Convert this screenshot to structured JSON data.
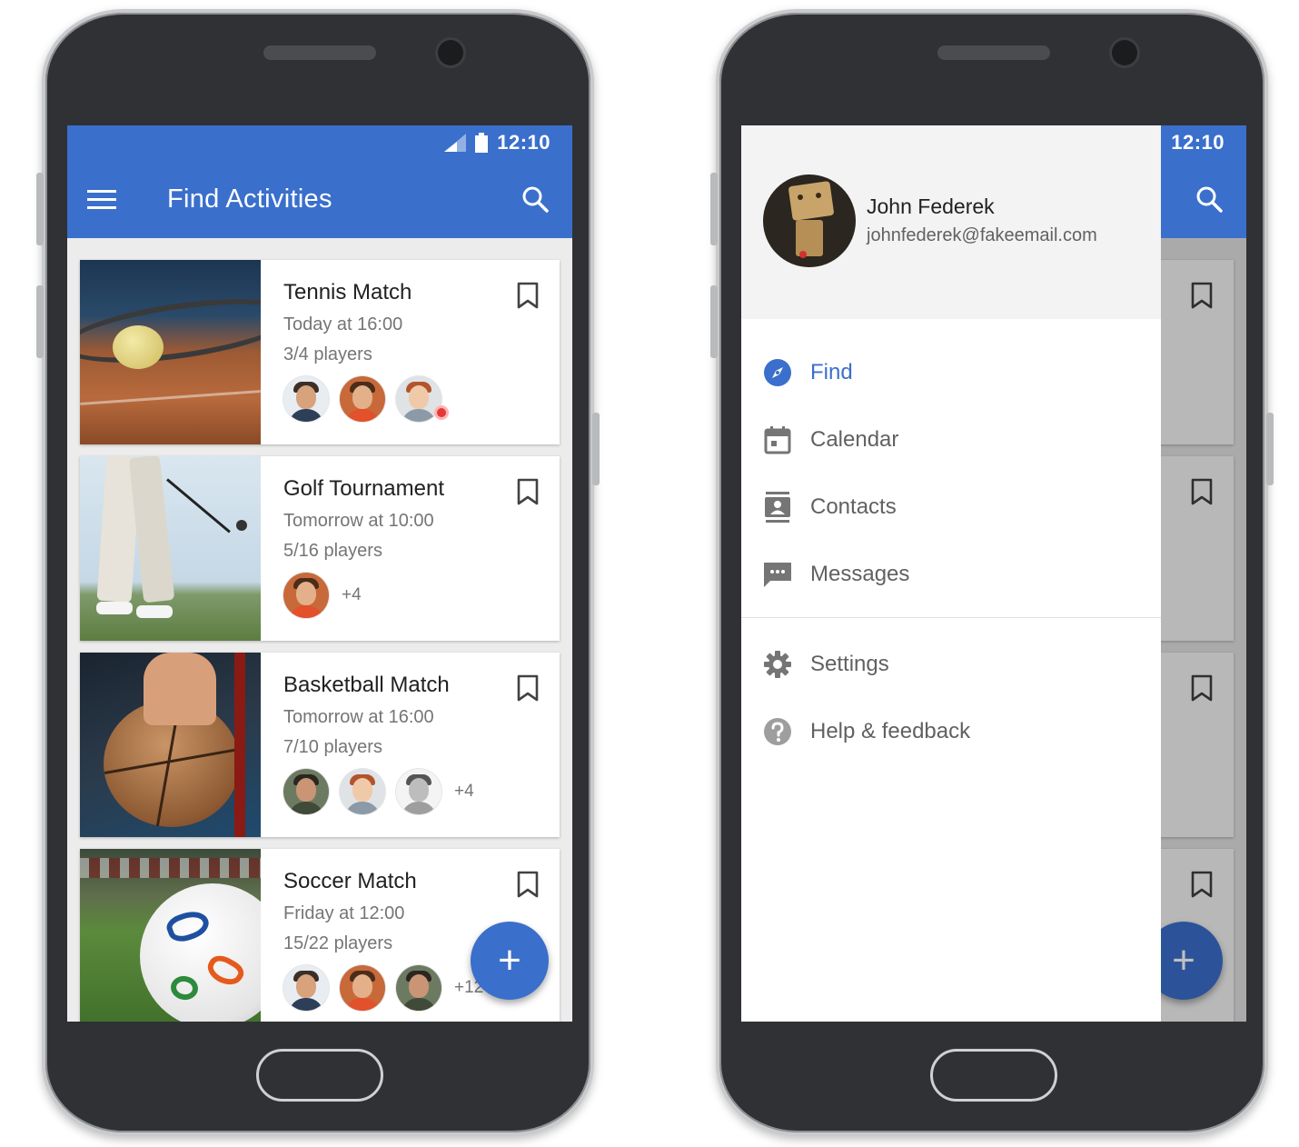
{
  "colors": {
    "primary": "#3a6fcc",
    "text_primary": "#212121",
    "text_secondary": "#757575",
    "phone_body": "#2f3134"
  },
  "status_bar": {
    "time": "12:10",
    "signal_icon": "signal-icon",
    "battery_icon": "battery-icon"
  },
  "toolbar": {
    "title": "Find Activities",
    "menu_icon": "menu-icon",
    "search_icon": "search-icon"
  },
  "activities": [
    {
      "name": "Tennis Match",
      "when": "Today at 16:00",
      "players": "3/4 players",
      "more": ""
    },
    {
      "name": "Golf Tournament",
      "when": "Tomorrow at 10:00",
      "players": "5/16 players",
      "more": "+4"
    },
    {
      "name": "Basketball Match",
      "when": "Tomorrow at 16:00",
      "players": "7/10 players",
      "more": "+4"
    },
    {
      "name": "Soccer Match",
      "when": "Friday at 12:00",
      "players": "15/22 players",
      "more": "+12"
    }
  ],
  "fab": {
    "label": "+",
    "icon": "add-icon"
  },
  "drawer": {
    "user": {
      "name": "John Federek",
      "email": "johnfederek@fakeemail.com"
    },
    "items": [
      {
        "label": "Find",
        "icon": "compass-icon",
        "active": true
      },
      {
        "label": "Calendar",
        "icon": "calendar-icon"
      },
      {
        "label": "Contacts",
        "icon": "contacts-icon"
      },
      {
        "label": "Messages",
        "icon": "messages-icon"
      }
    ],
    "secondary_items": [
      {
        "label": "Settings",
        "icon": "gear-icon"
      },
      {
        "label": "Help & feedback",
        "icon": "help-icon"
      }
    ]
  }
}
